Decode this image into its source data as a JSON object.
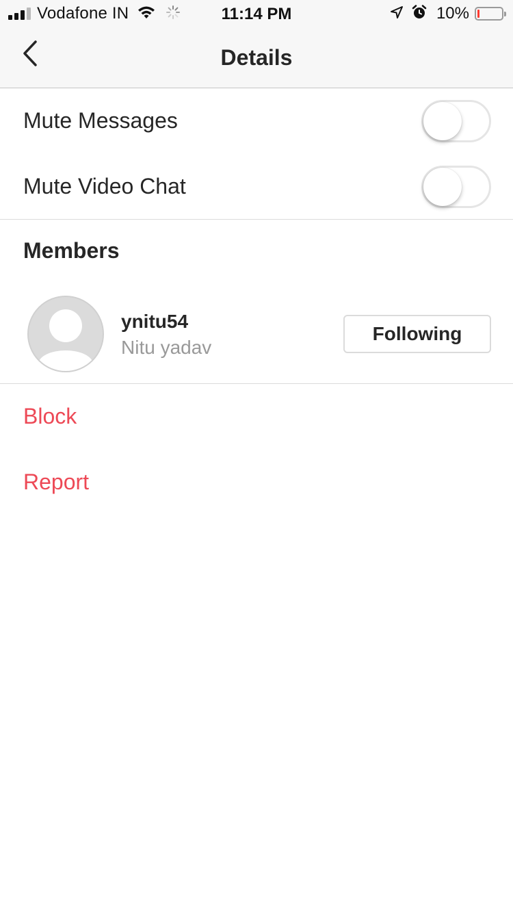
{
  "status_bar": {
    "carrier": "Vodafone IN",
    "time": "11:14 PM",
    "battery": "10%",
    "battery_level": 0.1,
    "signal_bars": 4,
    "signal_bars_filled": 3,
    "icons": [
      "signal-icon",
      "wifi-icon",
      "activity-spinner-icon",
      "location-arrow-icon",
      "alarm-clock-icon",
      "battery-icon"
    ]
  },
  "nav": {
    "title": "Details",
    "back_icon": "chevron-left-icon"
  },
  "settings": [
    {
      "label": "Mute Messages",
      "enabled": false
    },
    {
      "label": "Mute Video Chat",
      "enabled": false
    }
  ],
  "members": {
    "title": "Members",
    "items": [
      {
        "username": "ynitu54",
        "full_name": "Nitu yadav",
        "button_label": "Following",
        "avatar_icon": "default-avatar-icon"
      }
    ]
  },
  "actions": {
    "block": "Block",
    "report": "Report"
  },
  "colors": {
    "danger": "#ed4956",
    "secondary_text": "#999999",
    "primary_text": "#262626",
    "battery_low": "#ff3b30"
  }
}
